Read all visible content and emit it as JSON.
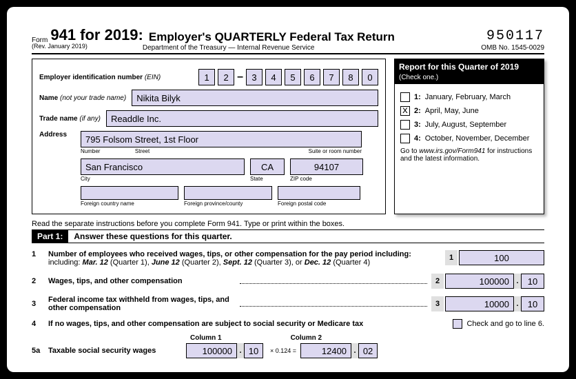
{
  "header": {
    "form_label": "Form",
    "form_number": "941 for 2019:",
    "title": "Employer's QUARTERLY Federal Tax Return",
    "rev": "(Rev. January 2019)",
    "dept": "Department of the Treasury — Internal Revenue Service",
    "code": "950117",
    "omb": "OMB No. 1545-0029"
  },
  "ein": {
    "label": "Employer identification number",
    "label_abbr": "(EIN)",
    "digits": [
      "1",
      "2",
      "3",
      "4",
      "5",
      "6",
      "7",
      "8",
      "0"
    ]
  },
  "name": {
    "label": "Name",
    "hint": "(not your trade name)",
    "value": "Nikita Bilyk"
  },
  "trade": {
    "label": "Trade name",
    "hint": "(if any)",
    "value": "Readdle Inc."
  },
  "address": {
    "label": "Address",
    "street": "795 Folsom Street, 1st Floor",
    "street_sub_l": "Number",
    "street_sub_m": "Street",
    "street_sub_r": "Suite or room number",
    "city": "San Francisco",
    "city_sub": "City",
    "state": "CA",
    "state_sub": "State",
    "zip": "94107",
    "zip_sub": "ZIP code",
    "fc_sub": "Foreign country name",
    "fp_sub": "Foreign province/county",
    "fz_sub": "Foreign postal code"
  },
  "quarter": {
    "title": "Report for this Quarter of 2019",
    "sub": "(Check one.)",
    "options": [
      {
        "num": "1:",
        "text": "January, February, March",
        "checked": ""
      },
      {
        "num": "2:",
        "text": "April, May, June",
        "checked": "x"
      },
      {
        "num": "3:",
        "text": "July, August, September",
        "checked": ""
      },
      {
        "num": "4:",
        "text": "October, November, December",
        "checked": ""
      }
    ],
    "go_text": "Go to",
    "go_url": "www.irs.gov/Form941",
    "go_suffix": "for instructions and the latest information."
  },
  "instruct": "Read the separate instructions before you complete Form 941. Type or print within the boxes.",
  "part1": {
    "label": "Part 1:",
    "text": "Answer these questions for this quarter."
  },
  "lines": {
    "l1": {
      "num": "1",
      "text": "Number of employees who received wages, tips, or other compensation for the pay period including:",
      "text2_a": "Mar. 12",
      "text2_b": " (Quarter 1), ",
      "text2_c": "June 12",
      "text2_d": " (Quarter 2), ",
      "text2_e": "Sept. 12",
      "text2_f": " (Quarter 3), or ",
      "text2_g": "Dec. 12",
      "text2_h": " (Quarter 4)",
      "box": "1",
      "value": "100"
    },
    "l2": {
      "num": "2",
      "text": "Wages, tips, and other compensation",
      "box": "2",
      "v1": "100000",
      "v2": "10"
    },
    "l3": {
      "num": "3",
      "text": "Federal income tax withheld from wages, tips, and other compensation",
      "box": "3",
      "v1": "10000",
      "v2": "10"
    },
    "l4": {
      "num": "4",
      "text": "If no wages, tips, and other compensation are subject to social security or Medicare tax",
      "check": "Check and go to line 6."
    },
    "col1": "Column 1",
    "col2": "Column 2",
    "l5a": {
      "num": "5a",
      "text": "Taxable social security wages",
      "c1v1": "100000",
      "c1v2": "10",
      "mult": "× 0.124 =",
      "c2v1": "12400",
      "c2v2": "02"
    }
  }
}
